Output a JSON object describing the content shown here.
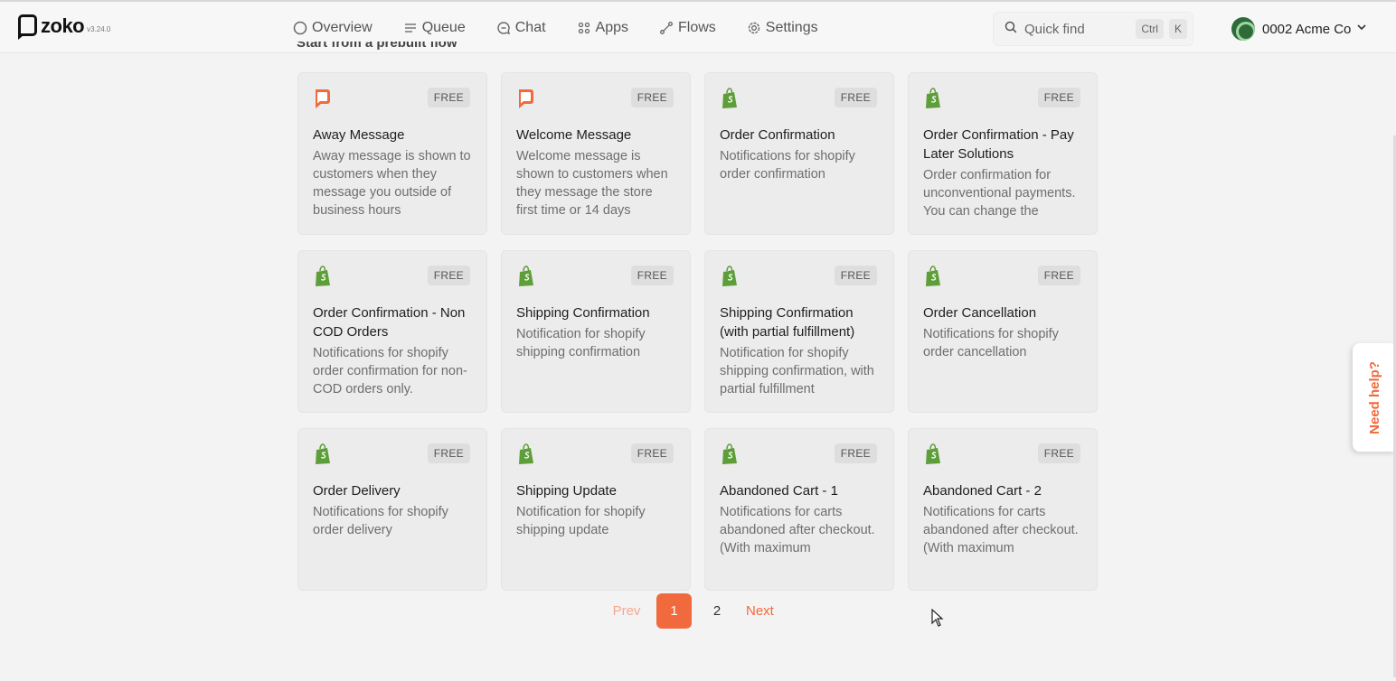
{
  "app": {
    "name": "zoko",
    "version": "v3.24.0"
  },
  "nav": [
    {
      "label": "Overview",
      "icon": "circle-icon"
    },
    {
      "label": "Queue",
      "icon": "list-icon"
    },
    {
      "label": "Chat",
      "icon": "chat-icon"
    },
    {
      "label": "Apps",
      "icon": "apps-grid-icon"
    },
    {
      "label": "Flows",
      "icon": "flows-icon"
    },
    {
      "label": "Settings",
      "icon": "gear-icon"
    }
  ],
  "search": {
    "placeholder": "Quick find",
    "shortcut_1": "Ctrl",
    "shortcut_2": "K"
  },
  "account": {
    "name": "0002 Acme Co"
  },
  "section": {
    "heading": "Start from a prebuilt flow"
  },
  "badge_label": "FREE",
  "cards": [
    {
      "title": "Away Message",
      "desc": "Away message is shown to customers when they message you outside of business hours",
      "icon": "zoko"
    },
    {
      "title": "Welcome Message",
      "desc": "Welcome message is shown to customers when they message the store first time or 14 days",
      "icon": "zoko"
    },
    {
      "title": "Order Confirmation",
      "desc": "Notifications for shopify order confirmation",
      "icon": "shopify"
    },
    {
      "title": "Order Confirmation - Pay Later Solutions",
      "desc": "Order confirmation for unconventional payments. You can change the",
      "icon": "shopify"
    },
    {
      "title": "Order Confirmation - Non COD Orders",
      "desc": "Notifications for shopify order confirmation for non-COD orders only.",
      "icon": "shopify"
    },
    {
      "title": "Shipping Confirmation",
      "desc": "Notification for shopify shipping confirmation",
      "icon": "shopify"
    },
    {
      "title": "Shipping Confirmation (with partial fulfillment)",
      "desc": "Notification for shopify shipping confirmation, with partial fulfillment",
      "icon": "shopify"
    },
    {
      "title": "Order Cancellation",
      "desc": "Notifications for shopify order cancellation",
      "icon": "shopify"
    },
    {
      "title": "Order Delivery",
      "desc": "Notifications for shopify order delivery",
      "icon": "shopify"
    },
    {
      "title": "Shipping Update",
      "desc": "Notification for shopify shipping update",
      "icon": "shopify"
    },
    {
      "title": "Abandoned Cart - 1",
      "desc": "Notifications for carts abandoned after checkout. (With maximum",
      "icon": "shopify"
    },
    {
      "title": "Abandoned Cart - 2",
      "desc": "Notifications for carts abandoned after checkout. (With maximum",
      "icon": "shopify"
    }
  ],
  "pagination": {
    "prev": "Prev",
    "current": "1",
    "page2": "2",
    "next": "Next"
  },
  "help": {
    "label": "Need help?"
  },
  "colors": {
    "accent": "#f06a3e",
    "shopify_green": "#5e9e3a"
  }
}
